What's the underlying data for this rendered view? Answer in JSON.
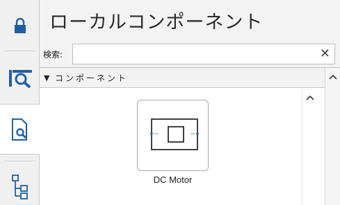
{
  "sidebar": {
    "items": [
      {
        "icon": "lock-icon"
      },
      {
        "icon": "library-search-icon"
      },
      {
        "icon": "document-search-icon",
        "active": true
      },
      {
        "icon": "tree-hierarchy-icon"
      }
    ]
  },
  "header": {
    "title": "ローカルコンポーネント"
  },
  "search": {
    "label": "検索:",
    "value": "",
    "clear_glyph": "✕"
  },
  "section": {
    "arrow_glyph": "▼",
    "title": "コンポーネント"
  },
  "components": [
    {
      "name": "DC Motor",
      "icon": "dc-motor-block-icon"
    }
  ],
  "colors": {
    "accent": "#1f5fa0",
    "rail_bg": "#f0f0f0",
    "panel_bg": "#f3f3f3"
  }
}
